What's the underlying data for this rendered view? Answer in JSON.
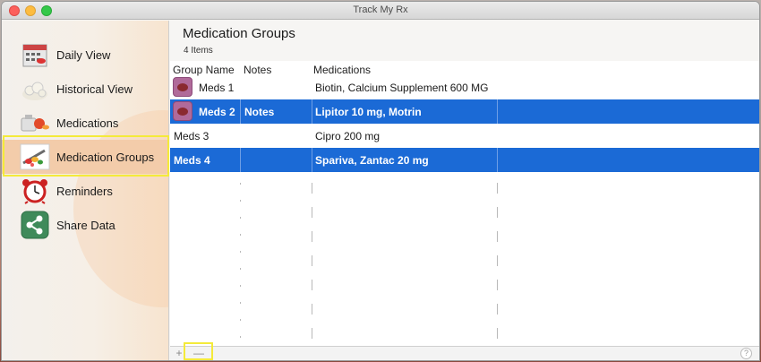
{
  "window": {
    "title": "Track My Rx"
  },
  "sidebar": {
    "items": [
      {
        "label": "Daily View",
        "icon": "daily-view-icon"
      },
      {
        "label": "Historical View",
        "icon": "historical-view-icon"
      },
      {
        "label": "Medications",
        "icon": "medications-icon"
      },
      {
        "label": "Medication Groups",
        "icon": "medication-groups-icon",
        "selected": true
      },
      {
        "label": "Reminders",
        "icon": "alarm-clock-icon"
      },
      {
        "label": "Share Data",
        "icon": "share-icon"
      }
    ]
  },
  "main": {
    "title": "Medication Groups",
    "count": "4 Items",
    "columns": [
      "Group Name",
      "Notes",
      "Medications"
    ],
    "rows": [
      {
        "name": "Meds 1",
        "notes": "",
        "medications": "Biotin, Calcium Supplement 600 MG",
        "has_icon": true,
        "selected": false
      },
      {
        "name": "Meds 2",
        "notes": "Notes",
        "medications": "Lipitor 10 mg, Motrin",
        "has_icon": true,
        "selected": true
      },
      {
        "name": "Meds 3",
        "notes": "",
        "medications": "Cipro 200 mg",
        "has_icon": false,
        "selected": false
      },
      {
        "name": "Meds 4",
        "notes": "",
        "medications": "Spariva, Zantac 20 mg",
        "has_icon": false,
        "selected": true
      }
    ]
  },
  "footer": {
    "add_label": "+",
    "remove_label": "—",
    "help_label": "?"
  },
  "colors": {
    "selection": "#1b6ad6",
    "sidebar_selected": "#f3ccaa",
    "annotation_highlight": "#f4ea3a"
  }
}
